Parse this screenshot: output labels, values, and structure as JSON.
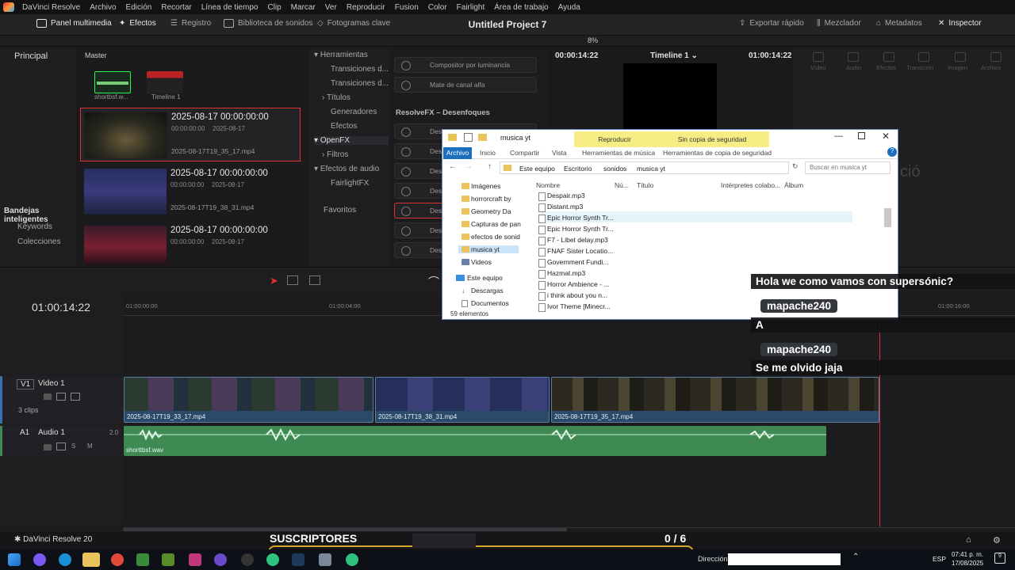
{
  "app": {
    "menu": [
      "DaVinci Resolve",
      "Archivo",
      "Edición",
      "Recortar",
      "Línea de tiempo",
      "Clip",
      "Marcar",
      "Ver",
      "Reproducir",
      "Fusion",
      "Color",
      "Fairlight",
      "Área de trabajo",
      "Ayuda"
    ],
    "project_title": "Untitled Project 7"
  },
  "toolbar": {
    "media_pool": "Panel multimedia",
    "effects": "Efectos",
    "index": "Registro",
    "sound_library": "Biblioteca de sonidos",
    "keyframes": "Fotogramas clave",
    "quick_export": "Exportar rápido",
    "mixer": "Mezclador",
    "metadata": "Metadatos",
    "inspector": "Inspector",
    "zoom": "8%"
  },
  "media_pool": {
    "bins_header": "Principal",
    "master": "Master",
    "small_items": [
      {
        "name": "shortbsf.w..."
      },
      {
        "name": "Timeline 1"
      }
    ],
    "clips": [
      {
        "date": "2025-08-17  00:00:00:00",
        "tc": "00:00:00:00",
        "d2": "2025-08-17",
        "file": "2025-08-17T19_35_17.mp4",
        "selected": true
      },
      {
        "date": "2025-08-17  00:00:00:00",
        "tc": "00:00:00:00",
        "d2": "2025-08-17",
        "file": "2025-08-17T19_38_31.mp4",
        "selected": false
      },
      {
        "date": "2025-08-17  00:00:00:00",
        "tc": "00:00:00:00",
        "d2": "2025-08-17",
        "file": "",
        "selected": false
      }
    ],
    "smart_bins": "Bandejas inteligentes",
    "keywords": "Keywords",
    "collections": "Colecciones"
  },
  "effects_tree": {
    "toolbox": "Herramientas",
    "items": [
      "Transiciones d...",
      "Transiciones d...",
      "Títulos",
      "Generadores",
      "Efectos"
    ],
    "openfx": "OpenFX",
    "filters": "Filtros",
    "audio_fx": "Efectos de audio",
    "fairlight_fx": "FairlightFX",
    "favorites": "Favoritos"
  },
  "effects_list": {
    "top": [
      "Compositor por luminancia",
      "Mate de canal alfa"
    ],
    "section": "ResolveFX – Desenfoques",
    "rows": [
      "Desen",
      "Desen",
      "Desen",
      "Desen",
      "Desen",
      "Desen",
      "Desen"
    ]
  },
  "viewer": {
    "left_tc": "00:00:14:22",
    "timeline_name": "Timeline 1",
    "right_tc": "01:00:14:22"
  },
  "inspector_tabs": [
    "Vídeo",
    "Audio",
    "Efectos",
    "Transición",
    "Imagen",
    "Archivo"
  ],
  "inspector_ghost": "ció",
  "explorer": {
    "title": "musica yt",
    "ctx_play": "Reproducir",
    "ctx_backup": "Sin copia de seguridad",
    "ribbon": [
      "Archivo",
      "Inicio",
      "Compartir",
      "Vista",
      "Herramientas de música",
      "Herramientas de copia de seguridad"
    ],
    "breadcrumb": [
      "Este equipo",
      "Escritorio",
      "sonidos",
      "musica yt"
    ],
    "search_placeholder": "Buscar en musica yt",
    "nav": [
      "Imágenes",
      "horrorcraft by",
      "Geometry Da",
      "Capturas de pan",
      "efectos de sonid",
      "musica yt",
      "Videos",
      "Este equipo",
      "Descargas",
      "Documentos"
    ],
    "columns": [
      "Nombre",
      "Nú...",
      "Título",
      "Intérpretes colabo...",
      "Álbum"
    ],
    "files": [
      "Despair.mp3",
      "Distant.mp3",
      "Epic Horror Synth Tr...",
      "Epic Horror Synth Tr...",
      "F7 - Libet delay.mp3",
      "FNAF Sister Locatio...",
      "Government Fundi...",
      "Hazmat.mp3",
      "Horror Ambience - ...",
      "i think about you n...",
      "Ivor Theme [Minecr..."
    ],
    "status": "59 elementos"
  },
  "timeline": {
    "timecode": "01:00:14:22",
    "ruler": [
      "01:00:00:00",
      "01:00:04:00",
      "01:00:16:00"
    ],
    "v1_label": "V1",
    "v1_name": "Video 1",
    "v1_clips": "3 clips",
    "a1_label": "A1",
    "a1_name": "Audio 1",
    "a1_level": "2.0",
    "video_clips": [
      "2025-08-17T19_33_17.mp4",
      "2025-08-17T19_38_31.mp4",
      "2025-08-17T19_35_17.mp4"
    ],
    "audio_clip": "shorttbsf.wav",
    "ghost_right": "Ajustar"
  },
  "chat": {
    "msg1": "Hola we como vamos con supersónic?",
    "user1": "mapache240",
    "msg2": "A",
    "user2": "mapache240",
    "msg3": "Se me olvido jaja"
  },
  "overlay": {
    "subs_label": "SUSCRIPTORES",
    "subs_count": "0 / 6",
    "subs_progress": 0
  },
  "statusbar": {
    "app_version": "DaVinci Resolve 20"
  },
  "taskbar": {
    "direction_label": "Dirección",
    "lang": "ESP",
    "time": "07:41 p. m.",
    "date": "17/08/2025",
    "notif_count": "9"
  }
}
